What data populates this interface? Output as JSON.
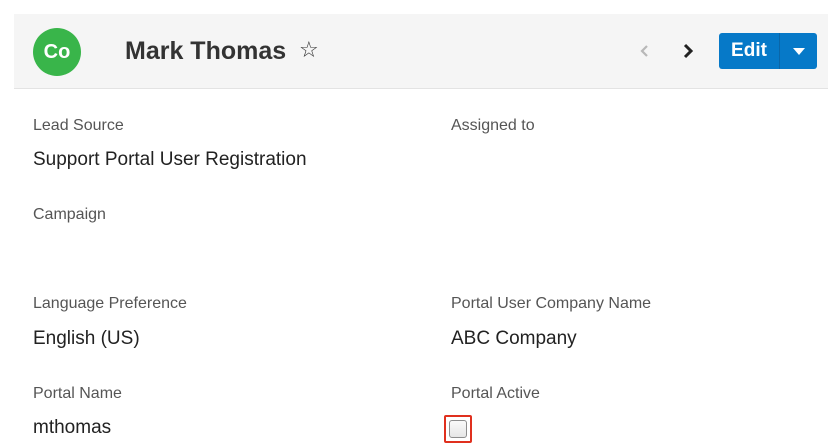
{
  "header": {
    "avatar_initials": "Co",
    "record_name": "Mark Thomas",
    "favorite_icon": "star-outline-icon",
    "prev_icon": "chevron-left-icon",
    "next_icon": "chevron-right-icon",
    "edit_label": "Edit",
    "edit_caret_icon": "caret-down-icon"
  },
  "fields": {
    "lead_source": {
      "label": "Lead Source",
      "value": "Support Portal User Registration"
    },
    "assigned_to": {
      "label": "Assigned to",
      "value": ""
    },
    "campaign": {
      "label": "Campaign",
      "value": ""
    },
    "language_preference": {
      "label": "Language Preference",
      "value": "English (US)"
    },
    "portal_user_company_name": {
      "label": "Portal User Company Name",
      "value": "ABC Company"
    },
    "portal_name": {
      "label": "Portal Name",
      "value": "mthomas"
    },
    "portal_active": {
      "label": "Portal Active",
      "checked": false
    }
  },
  "colors": {
    "avatar": "#39b54a",
    "edit_button": "#0679c8",
    "highlight": "#e0301e"
  }
}
